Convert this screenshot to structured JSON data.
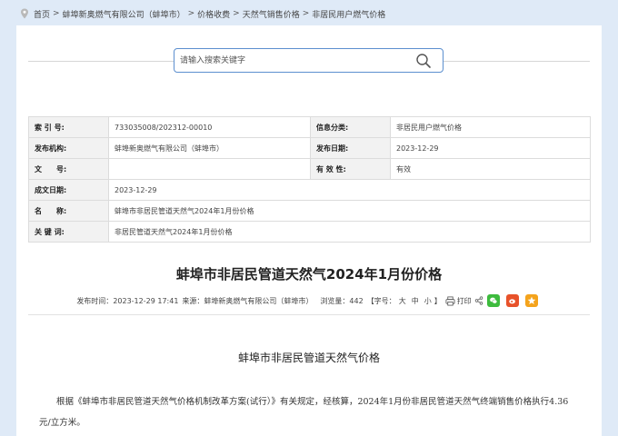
{
  "breadcrumb": {
    "items": [
      "首页",
      "蚌埠新奥燃气有限公司（蚌埠市）",
      "价格收费",
      "天然气销售价格",
      "非居民用户燃气价格"
    ],
    "separator": ">"
  },
  "search": {
    "placeholder": "请输入搜索关键字"
  },
  "meta": {
    "index_label": "索 引 号:",
    "index_value": "733035008/202312-00010",
    "category_label": "信息分类:",
    "category_value": "非居民用户燃气价格",
    "publisher_label": "发布机构:",
    "publisher_value": "蚌埠新奥燃气有限公司（蚌埠市）",
    "publish_date_label": "发布日期:",
    "publish_date_value": "2023-12-29",
    "doc_no_label": "文　　号:",
    "doc_no_value": "",
    "validity_label": "有 效 性:",
    "validity_value": "有效",
    "created_label": "成文日期:",
    "created_value": "2023-12-29",
    "name_label": "名　　称:",
    "name_value": "蚌埠市非居民管道天然气2024年1月份价格",
    "keywords_label": "关 键 词:",
    "keywords_value": "非居民管道天然气2024年1月份价格"
  },
  "article": {
    "title": "蚌埠市非居民管道天然气2024年1月份价格",
    "publish_time_label": "发布时间：",
    "publish_time": "2023-12-29 17:41",
    "source_label": "来源：",
    "source": "蚌埠新奥燃气有限公司（蚌埠市）",
    "views_label": "浏览量：",
    "views": "442",
    "font_label": "【字号：",
    "font_large": "大",
    "font_medium": "中",
    "font_small": "小",
    "font_end": "】",
    "print_label": "打印",
    "subtitle": "蚌埠市非居民管道天然气价格",
    "body": "根据《蚌埠市非居民管道天然气价格机制改革方案(试行）》有关规定，经核算，2024年1月份非居民管道天然气终端销售价格执行4.36元/立方米。"
  },
  "icons": {
    "pin": "location-pin-icon",
    "search": "search-icon",
    "print": "printer-icon",
    "share": "share-icon",
    "wechat": "wechat-icon",
    "weibo": "weibo-icon",
    "qzone": "qzone-star-icon"
  },
  "colors": {
    "background": "#dfeaf7",
    "search_border": "#5c8fcf",
    "wechat": "#3dbb3d",
    "weibo": "#e8522a",
    "qzone": "#f4a31c"
  }
}
